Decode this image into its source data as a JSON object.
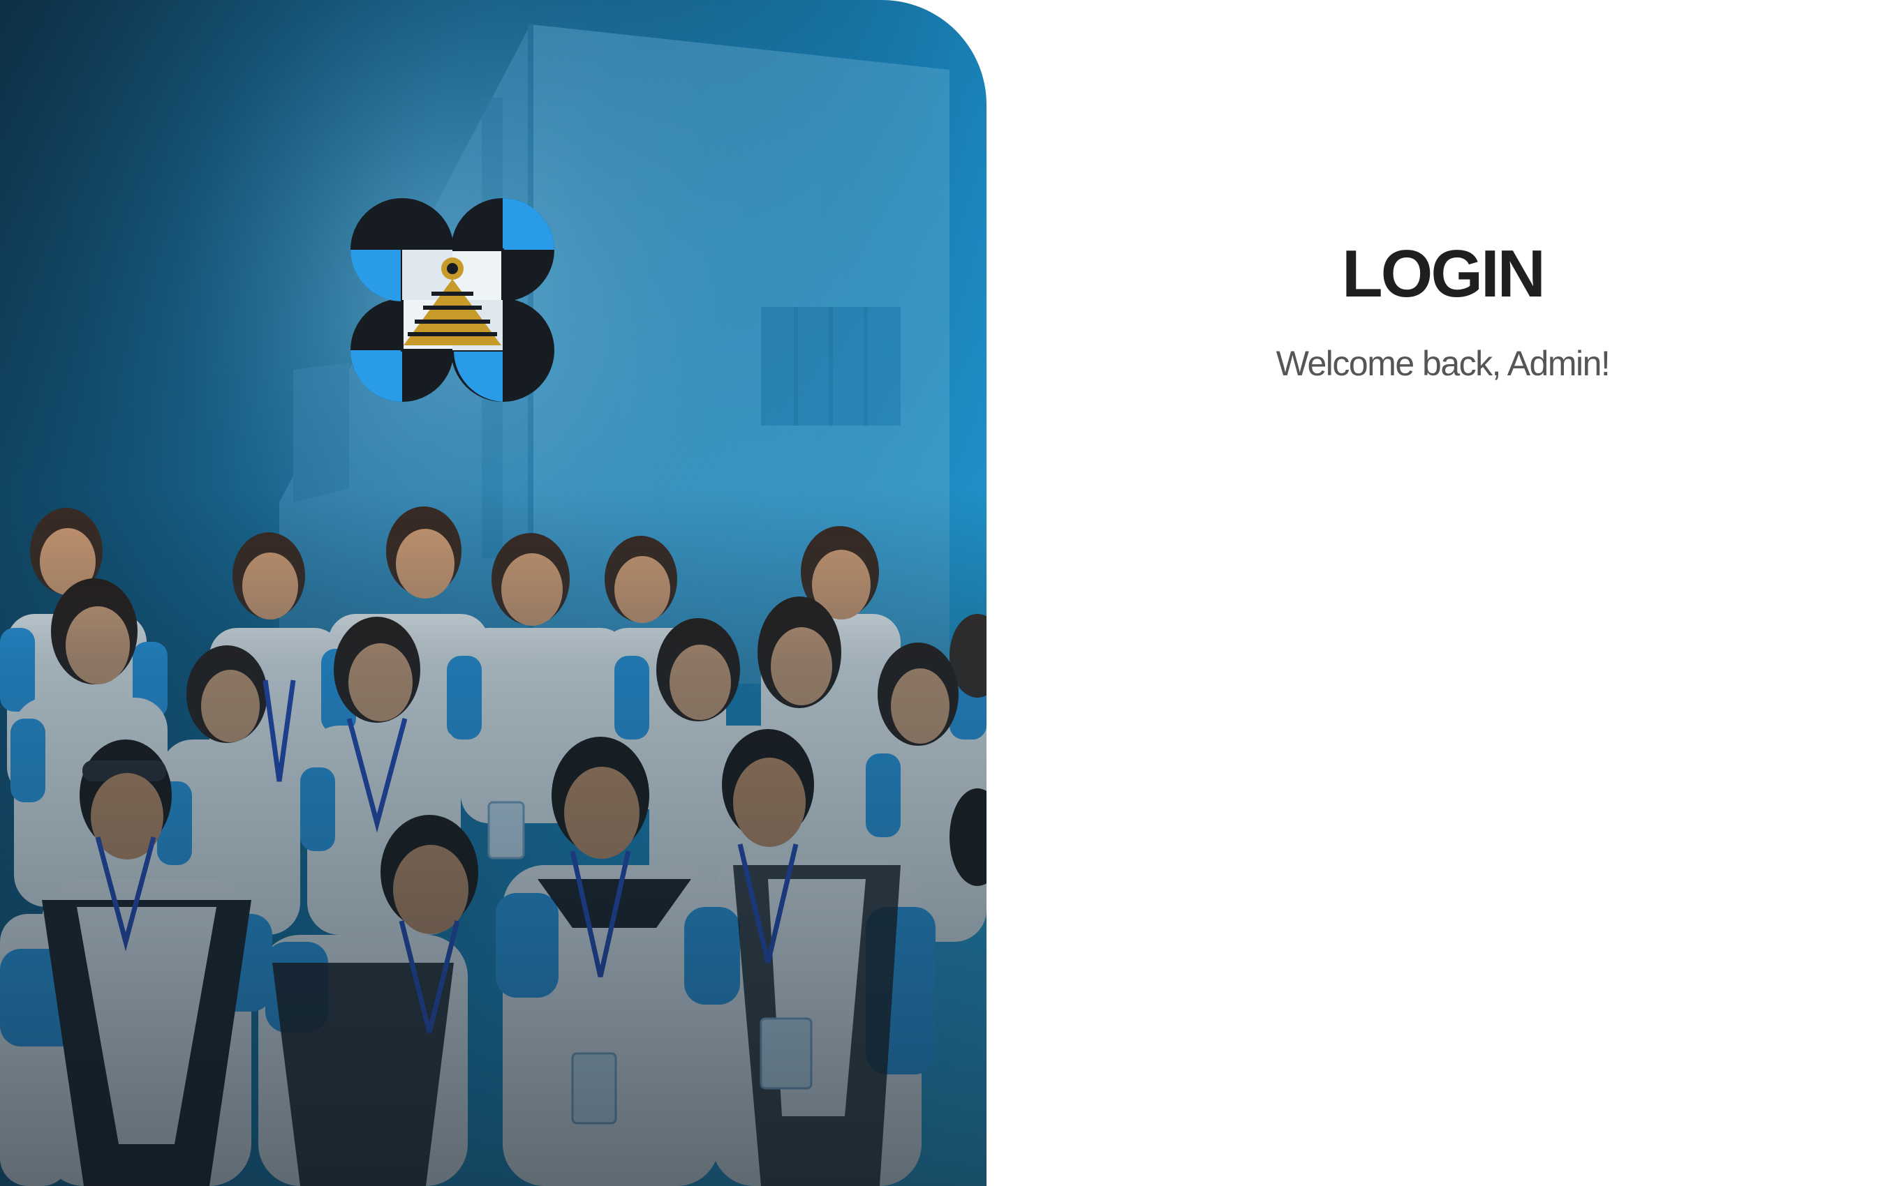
{
  "hero": {
    "logo": "agency-logo-emblem",
    "photo": "group-photo-students-in-uniform"
  },
  "login": {
    "title": "LOGIN",
    "subtitle": "Welcome back, Admin!"
  },
  "colors": {
    "hero_dark": "#0d2f45",
    "hero_mid": "#1a86bd",
    "hero_light": "#2aa4d8",
    "logo_blue": "#2a9be6",
    "logo_gold": "#c79b2a",
    "title_text": "#1f1f1f",
    "subtitle_text": "#555555"
  }
}
